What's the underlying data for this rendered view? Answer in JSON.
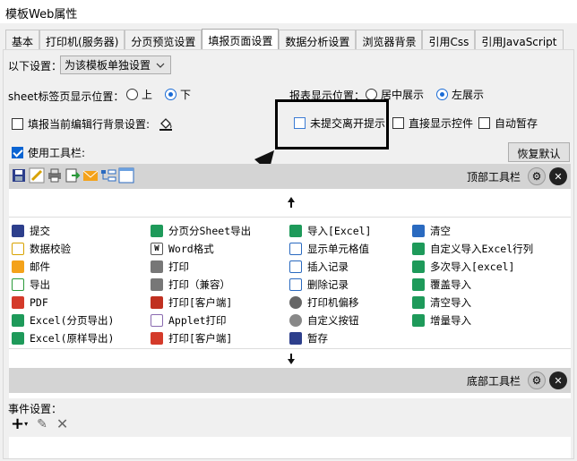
{
  "window": {
    "title": "模板Web属性"
  },
  "tabs": [
    {
      "label": "基本"
    },
    {
      "label": "打印机(服务器)"
    },
    {
      "label": "分页预览设置"
    },
    {
      "label": "填报页面设置"
    },
    {
      "label": "数据分析设置"
    },
    {
      "label": "浏览器背景"
    },
    {
      "label": "引用Css"
    },
    {
      "label": "引用JavaScript"
    }
  ],
  "settings": {
    "scope_label": "以下设置：",
    "scope_value": "为该模板单独设置",
    "sheet_pos_label": "sheet标签页显示位置：",
    "sheet_top": "上",
    "sheet_bottom": "下",
    "report_pos_label": "报表显示位置：",
    "report_center": "居中展示",
    "report_left": "左展示",
    "fill_bg_label": "填报当前编辑行背景设置:",
    "unsubmitted_label": "未提交离开提示",
    "direct_show_label": "直接显示控件",
    "autosave_label": "自动暂存",
    "use_toolbar_label": "使用工具栏:",
    "restore_label": "恢复默认"
  },
  "toolbar": {
    "top_label": "顶部工具栏",
    "bottom_label": "底部工具栏"
  },
  "items": [
    [
      "提交",
      "分页分Sheet导出",
      "导入[Excel]",
      "清空"
    ],
    [
      "数据校验",
      "Word格式",
      "显示单元格值",
      "自定义导入Excel行列"
    ],
    [
      "邮件",
      "打印",
      "插入记录",
      "多次导入[excel]"
    ],
    [
      "导出",
      "打印（兼容）",
      "删除记录",
      "覆盖导入"
    ],
    [
      "PDF",
      "打印[客户端]",
      "打印机偏移",
      "清空导入"
    ],
    [
      "Excel(分页导出)",
      "Applet打印",
      "自定义按钮",
      "增量导入"
    ],
    [
      "Excel(原样导出)",
      "打印[客户端]",
      "暂存",
      ""
    ]
  ],
  "events": {
    "label": "事件设置："
  },
  "colors": {
    "accent": "#0a64d2",
    "highlight_border": "#000000",
    "toolbar_bar": "#d4d4d4"
  }
}
